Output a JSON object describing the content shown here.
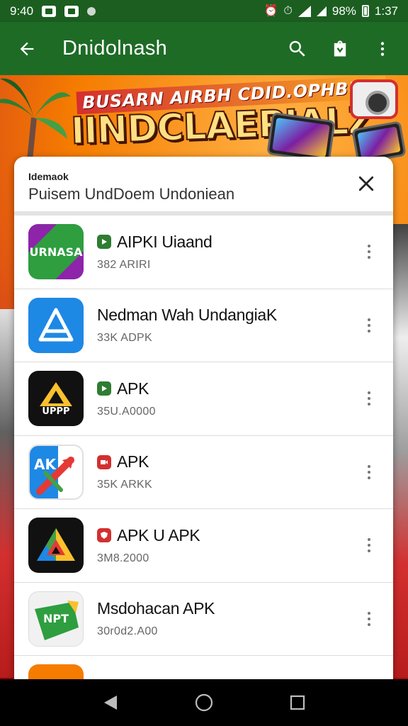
{
  "status_bar": {
    "left_time": "9:40",
    "battery": "98%",
    "clock": "1:37",
    "icons": [
      "image-icon",
      "bag-icon",
      "dot-icon",
      "alarm-off-icon",
      "alarm-icon",
      "wifi-icon",
      "signal-icon",
      "battery-icon"
    ]
  },
  "app_bar": {
    "title": "Dnidolnash",
    "back_icon": "arrow-left-icon",
    "search_icon": "search-icon",
    "store_icon": "shopping-bag-icon",
    "more_icon": "more-vert-icon",
    "color": "#1e6b26"
  },
  "banner": {
    "subtitle": "BUSARN AIRBH CDID.OPHBUM",
    "headline": "IINDCLAEPIALZ"
  },
  "sheet": {
    "kicker": "Idemaok",
    "title": "Puisem UndDoem Undoniean",
    "close_icon": "close-icon"
  },
  "apps": [
    {
      "name": "AIPKI Uiaand",
      "meta": "382 ARIRI",
      "badge": "green",
      "icon_label": "URNASA",
      "icon_name": "urnasa-app-icon"
    },
    {
      "name": "Nedman Wah UndangiaK",
      "meta": "33K ADPK",
      "badge": "none",
      "icon_label": "",
      "icon_name": "triangle-a-app-icon"
    },
    {
      "name": "APK",
      "meta": "35U.A0000",
      "badge": "green",
      "icon_label": "UPPP",
      "icon_name": "yellow-delta-app-icon"
    },
    {
      "name": "APK",
      "meta": "35K ARKK",
      "badge": "red",
      "icon_label": "AK",
      "icon_name": "ak-arrow-app-icon"
    },
    {
      "name": "APK U APK",
      "meta": "3M8.2000",
      "badge": "red",
      "icon_label": "",
      "icon_name": "colorful-triangle-app-icon"
    },
    {
      "name": "Msdohacan APK",
      "meta": "30r0d2.A00",
      "badge": "none",
      "icon_label": "NPT",
      "icon_name": "npt-app-icon"
    }
  ],
  "nav_bar": {
    "back_icon": "nav-back-icon",
    "home_icon": "nav-home-icon",
    "recents_icon": "nav-recents-icon"
  }
}
